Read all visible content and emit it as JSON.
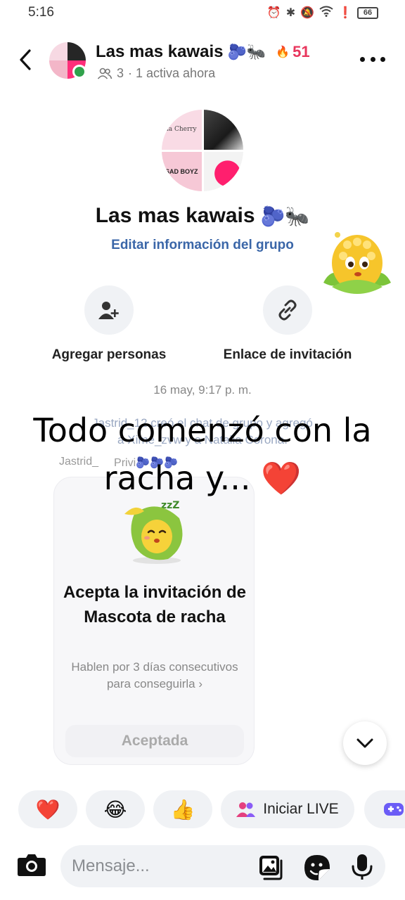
{
  "status_bar": {
    "time": "5:16",
    "battery": "66"
  },
  "header": {
    "title": "Las mas kawais",
    "title_emoji": "🫐🐜",
    "streak_count": "51",
    "members": "3",
    "active_status": "· 1 activa ahora"
  },
  "group_info": {
    "name": "Las mas kawais",
    "name_emoji": "🫐🐜",
    "edit_link": "Editar información del grupo",
    "avatar_text_top": "la Cherry",
    "avatar_text_bottom": "SAD BOYZ"
  },
  "actions": {
    "add_people": "Agregar personas",
    "invite_link": "Enlace de invitación"
  },
  "conversation": {
    "timestamp": "16 may, 9:17 p. m.",
    "system_message_line1": "Jastrid_12 creó el chat de grupo y agregó",
    "system_message_line2": "a Xime_zvw y a Natalia Corona.",
    "sender_1": "Jastrid_",
    "sender_2": "Privi🫐🫐🫐"
  },
  "overlay_caption": {
    "line1": "Todo comenzó con la",
    "line2": "racha y...",
    "heart": "❤️"
  },
  "streak_card": {
    "title": "Acepta la invitación de Mascota de racha",
    "description": "Hablen por 3 días consecutivos para conseguirla",
    "chevron": "›",
    "button": "Aceptada"
  },
  "quick_replies": {
    "heart": "❤️",
    "laugh": "😂",
    "thumb": "👍",
    "live_label": "Iniciar LIVE"
  },
  "composer": {
    "placeholder": "Mensaje..."
  },
  "colors": {
    "accent_link": "#3a66a8",
    "streak_red": "#e8365d",
    "online_green": "#31a24c",
    "live_icon": "#e4407f",
    "game_icon": "#6b5cf6"
  }
}
